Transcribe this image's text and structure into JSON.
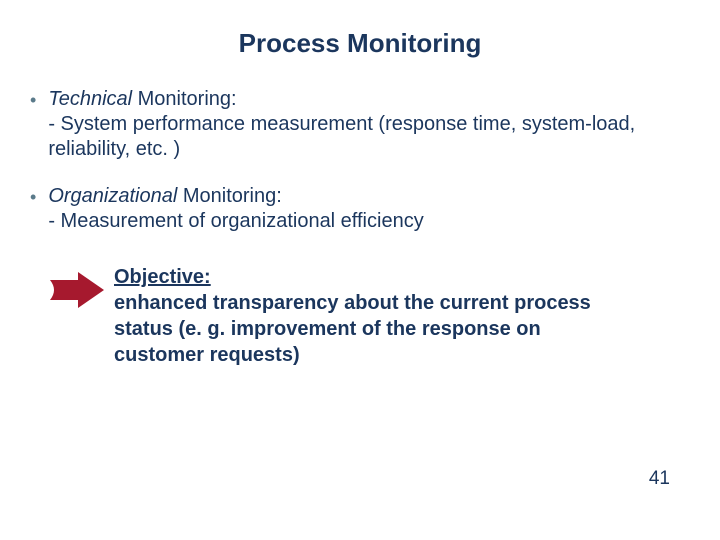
{
  "title": "Process Monitoring",
  "bullets": [
    {
      "heading": "Technical",
      "heading_suffix": "  Monitoring:",
      "body": "- System performance measurement (response time, system-load, reliability, etc. )"
    },
    {
      "heading": "Organizational",
      "heading_suffix": "  Monitoring:",
      "body": "- Measurement of organizational efficiency"
    }
  ],
  "objective": {
    "label": "Objective:",
    "text": "enhanced transparency about the current process status (e. g. improvement of the response on customer requests)"
  },
  "page_number": "41",
  "colors": {
    "text": "#1b365d",
    "bullet": "#5a7a8a",
    "arrow": "#a6192e"
  }
}
